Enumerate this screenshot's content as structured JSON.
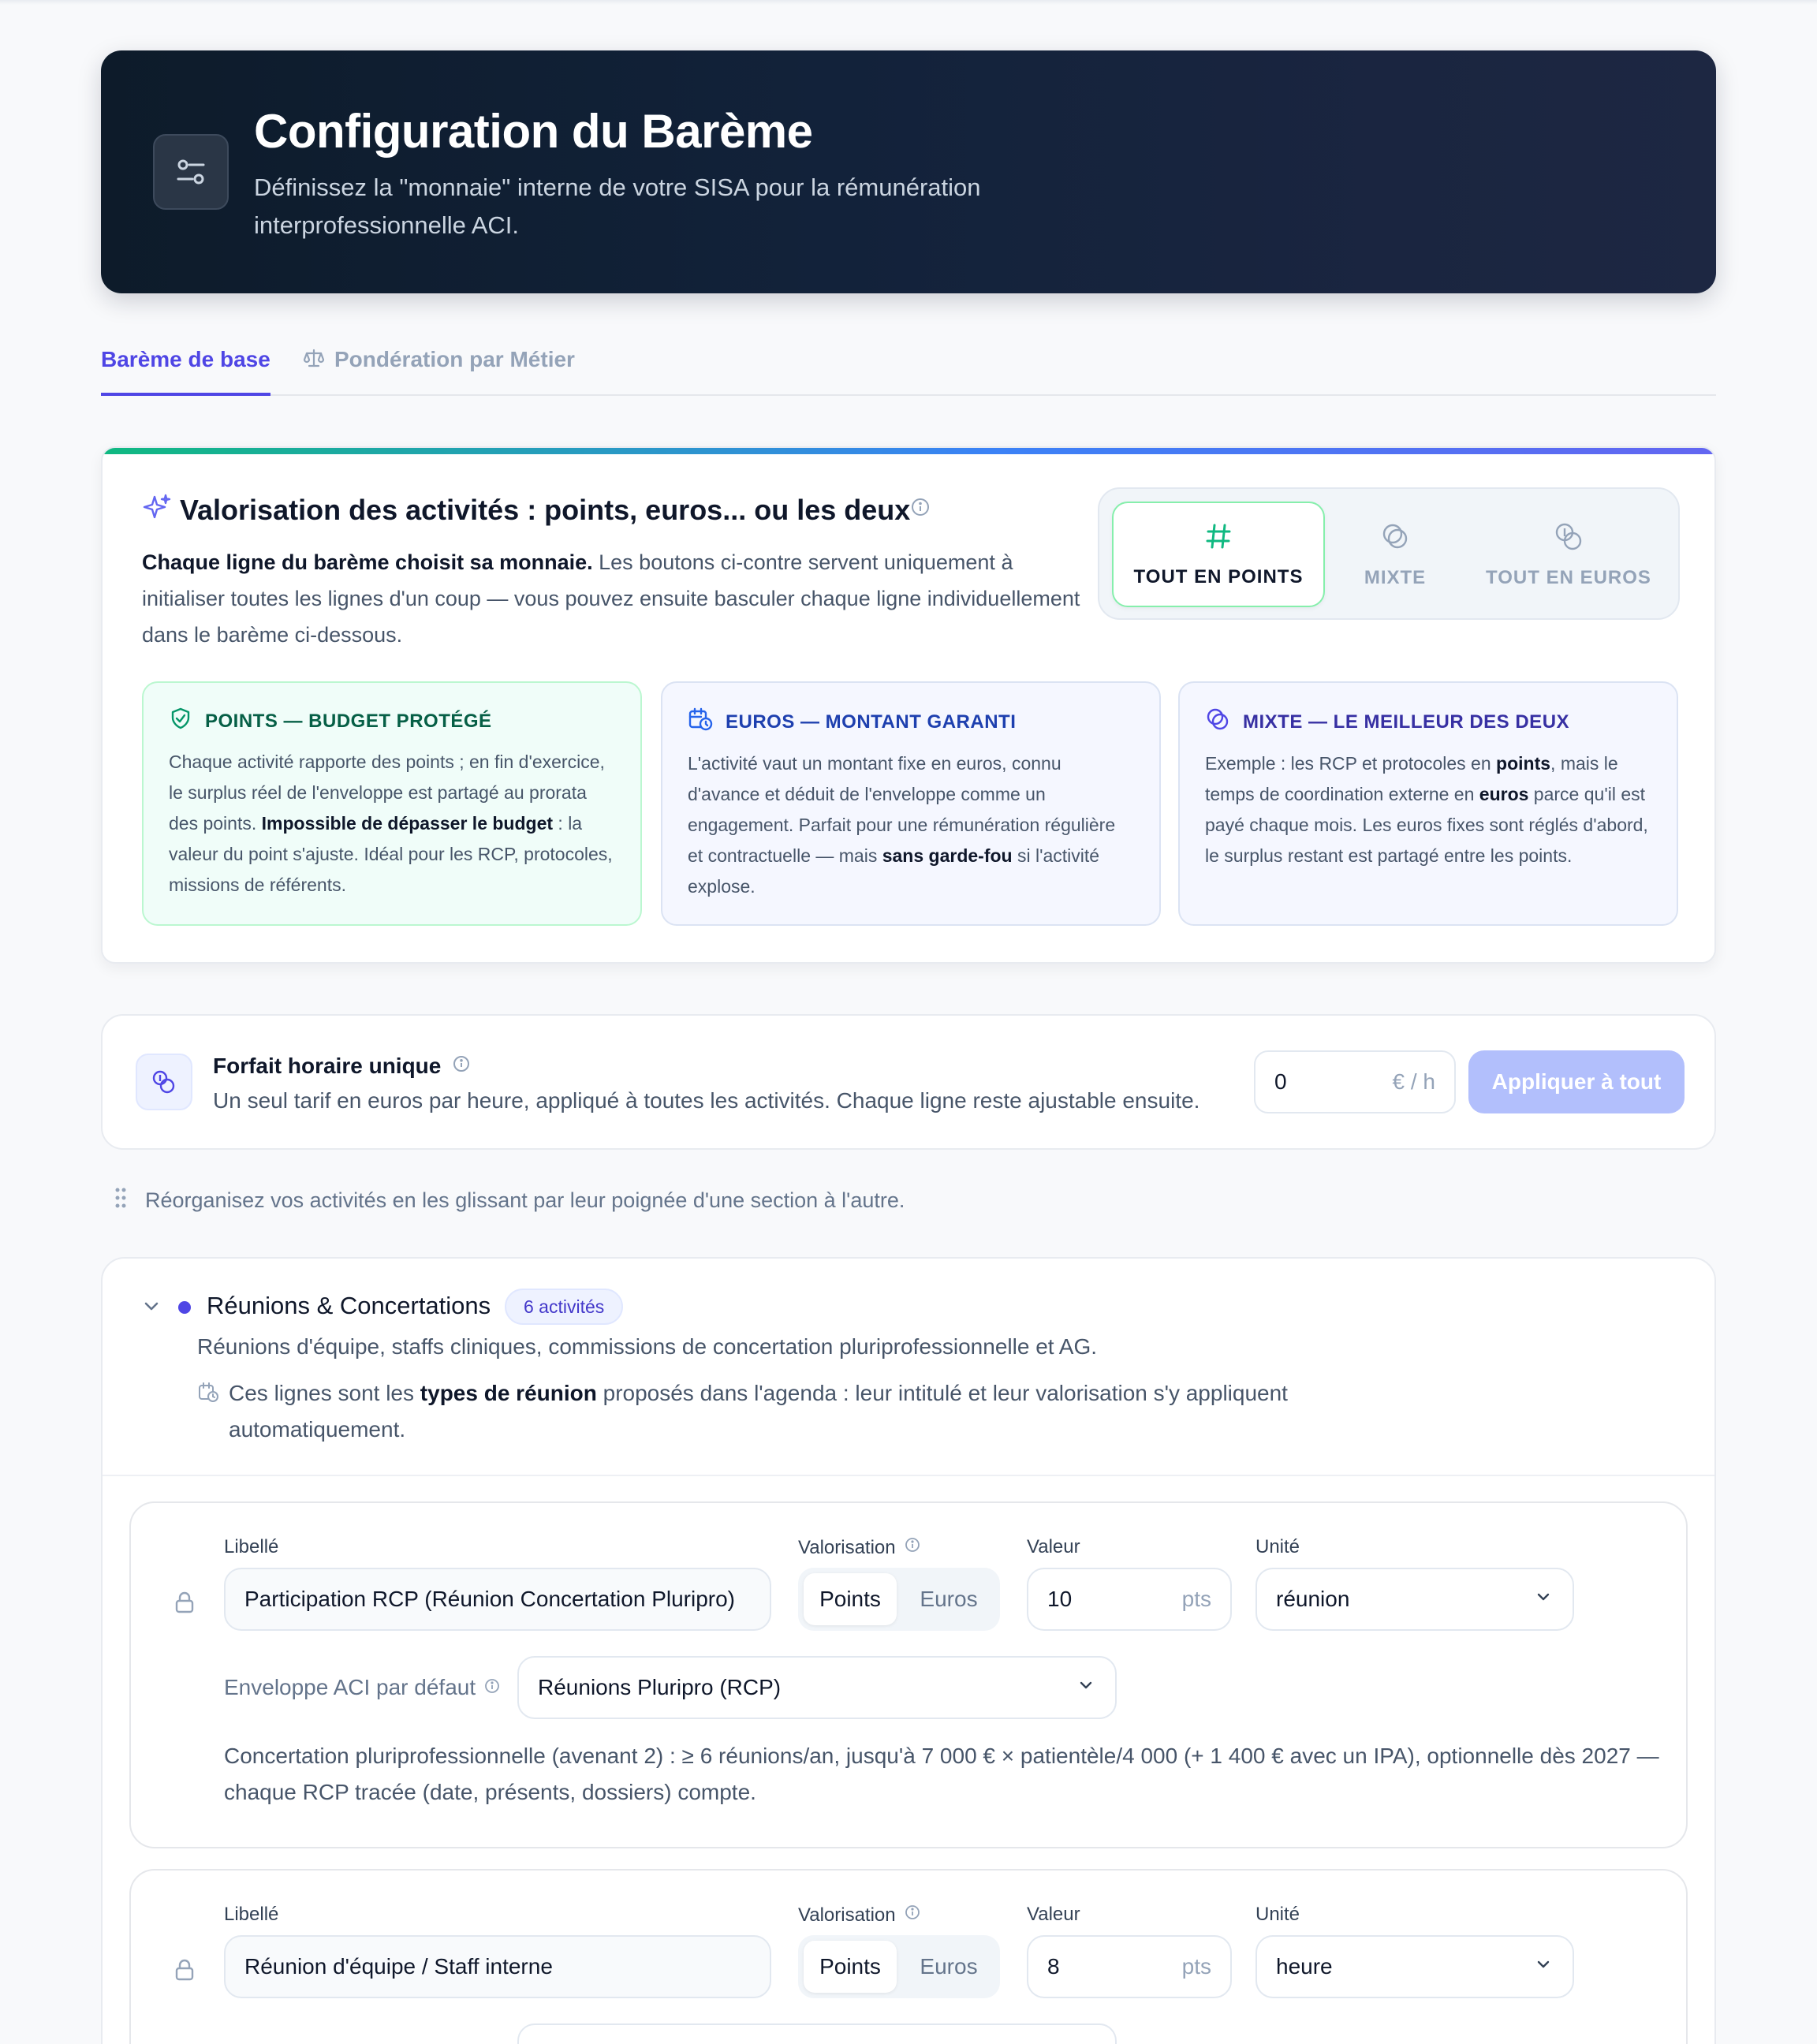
{
  "hero": {
    "title": "Configuration du Barème",
    "subtitle": "Définissez la \"monnaie\" interne de votre SISA pour la rémunération interprofessionnelle ACI.",
    "icon": "sliders-icon"
  },
  "tabs": [
    {
      "label": "Barème de base",
      "active": true
    },
    {
      "label": "Pondération par Métier",
      "active": false,
      "icon": "scale-icon"
    }
  ],
  "valorisation": {
    "title": "Valorisation des activités : points, euros... ou les deux",
    "desc_bold": "Chaque ligne du barème choisit sa monnaie.",
    "desc_rest": " Les boutons ci-contre servent uniquement à initialiser toutes les lignes d'un coup — vous pouvez ensuite basculer chaque ligne individuellement dans le barème ci-dessous.",
    "modes": [
      {
        "label": "TOUT EN POINTS",
        "active": true,
        "icon": "hash-icon"
      },
      {
        "label": "MIXTE",
        "active": false,
        "icon": "mixed-icon"
      },
      {
        "label": "TOUT EN EUROS",
        "active": false,
        "icon": "coins-icon"
      }
    ],
    "cards": {
      "points": {
        "title": "POINTS — BUDGET PROTÉGÉ",
        "t1": "Chaque activité rapporte des points ; en fin d'exercice, le surplus réel de l'enveloppe est partagé au prorata des points. ",
        "b1": "Impossible de dépasser le budget",
        "t2": " : la valeur du point s'ajuste. Idéal pour les RCP, protocoles, missions de référents."
      },
      "euros": {
        "title": "EUROS — MONTANT GARANTI",
        "t1": "L'activité vaut un montant fixe en euros, connu d'avance et déduit de l'enveloppe comme un engagement. Parfait pour une rémunération régulière et contractuelle — mais ",
        "b1": "sans garde-fou",
        "t2": " si l'activité explose."
      },
      "mixte": {
        "title": "MIXTE — LE MEILLEUR DES DEUX",
        "t1": "Exemple : les RCP et protocoles en ",
        "b1": "points",
        "t2": ", mais le temps de coordination externe en ",
        "b2": "euros",
        "t3": " parce qu'il est payé chaque mois. Les euros fixes sont réglés d'abord, le surplus restant est partagé entre les points."
      }
    }
  },
  "forfait": {
    "title": "Forfait horaire unique",
    "subtitle": "Un seul tarif en euros par heure, appliqué à toutes les activités. Chaque ligne reste ajustable ensuite.",
    "value": "0",
    "unit": "€ / h",
    "button": "Appliquer à tout"
  },
  "hint": "Réorganisez vos activités en les glissant par leur poignée d'une section à l'autre.",
  "section": {
    "title": "Réunions & Concertations",
    "badge": "6 activités",
    "description": "Réunions d'équipe, staffs cliniques, commissions de concertation pluriprofessionnelle et AG.",
    "note_pre": "Ces lignes sont les ",
    "note_bold": "types de réunion",
    "note_post": " proposés dans l'agenda : leur intitulé et leur valorisation s'y appliquent automatiquement.",
    "labels": {
      "libelle": "Libellé",
      "valorisation": "Valorisation",
      "valeur": "Valeur",
      "unite": "Unité",
      "enveloppe": "Enveloppe ACI par défaut",
      "points": "Points",
      "euros": "Euros",
      "pts": "pts"
    },
    "rows": [
      {
        "libelle": "Participation RCP (Réunion Concertation Pluripro)",
        "valorisation": "Points",
        "valeur": "10",
        "unite": "réunion",
        "enveloppe": "Réunions Pluripro (RCP)",
        "note": "Concertation pluriprofessionnelle (avenant 2) : ≥ 6 réunions/an, jusqu'à 7 000 € × patientèle/4 000 (+ 1 400 € avec un IPA), optionnelle dès 2027 — chaque RCP tracée (date, présents, dossiers) compte."
      },
      {
        "libelle": "Réunion d'équipe / Staff interne",
        "valorisation": "Points",
        "valeur": "8",
        "unite": "heure"
      }
    ]
  },
  "colors": {
    "accent": "#4f46e5",
    "hero_bg": "#0d1b2a",
    "points_green": "#10b981",
    "apply_button": "#a5b4fc"
  }
}
